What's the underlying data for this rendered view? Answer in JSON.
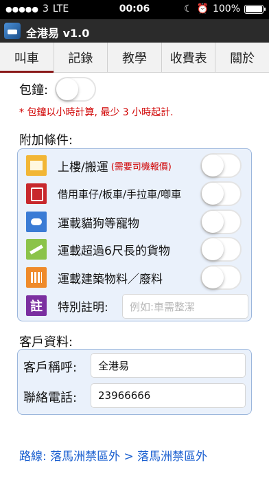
{
  "status_bar": {
    "signal_dots": "●●●●●",
    "carrier": "3",
    "network": "LTE",
    "time": "00:06",
    "moon_icon": "☾",
    "alarm_icon": "⏰",
    "battery_percent": "100%"
  },
  "title_bar": {
    "title": "全港易 v1.0"
  },
  "tabs": [
    {
      "label": "叫車",
      "active": true
    },
    {
      "label": "記錄",
      "active": false
    },
    {
      "label": "教學",
      "active": false
    },
    {
      "label": "收費表",
      "active": false
    },
    {
      "label": "關於",
      "active": false
    }
  ],
  "hourly": {
    "label": "包鐘:",
    "on": false,
    "note": "* 包鐘以小時計算, 最少 3 小時起計."
  },
  "options_section": {
    "title": "附加條件:",
    "items": [
      {
        "icon": "moving-icon",
        "label": "上樓/搬運",
        "sub": "(需要司機報價)",
        "on": false
      },
      {
        "icon": "trolley-icon",
        "label": "借用車仔/板車/手拉車/喞車",
        "on": false
      },
      {
        "icon": "dog-icon",
        "label": "運載貓狗等寵物",
        "on": false
      },
      {
        "icon": "long-goods-icon",
        "label": "運載超過6尺長的貨物",
        "on": false
      },
      {
        "icon": "building-material-icon",
        "label": "運載建築物料／廢料",
        "on": false
      }
    ],
    "remark": {
      "icon_text": "註",
      "label": "特別註明:",
      "placeholder": "例如:車需整潔"
    }
  },
  "customer_section": {
    "title": "客戶資料:",
    "name_label": "客戶稱呼:",
    "name_value": "全港易",
    "phone_label": "聯絡電話:",
    "phone_value": "23966666"
  },
  "route": {
    "text": "路線: 落馬洲禁區外 > 落馬洲禁區外"
  }
}
